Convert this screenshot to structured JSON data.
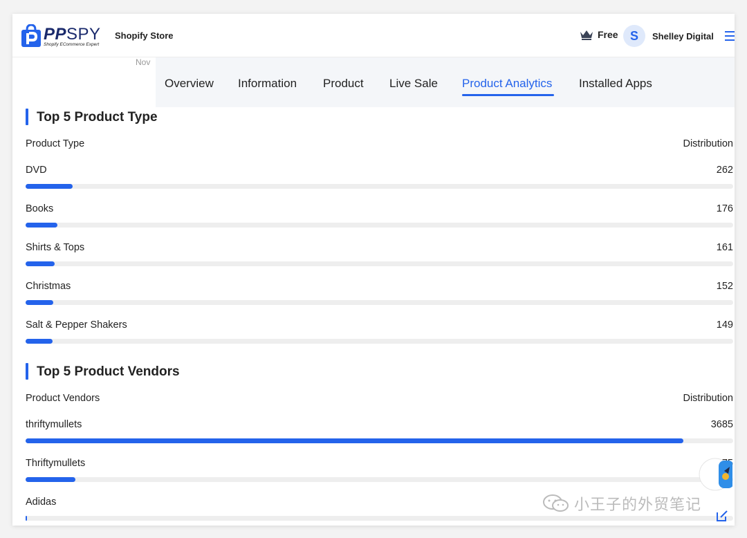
{
  "header": {
    "logo_text_pp": "PP",
    "logo_text_spy": "SPY",
    "logo_tagline": "Shopify ECommerce Expert",
    "store_label": "Shopify Store",
    "plan_icon": "crown-icon",
    "plan_label": "Free",
    "avatar_initial": "S",
    "user_name": "Shelley Digital",
    "menu_icon": "hamburger-menu-icon"
  },
  "nov_label": "Nov",
  "tabs": [
    {
      "label": "Overview",
      "active": false
    },
    {
      "label": "Information",
      "active": false
    },
    {
      "label": "Product",
      "active": false
    },
    {
      "label": "Live Sale",
      "active": false
    },
    {
      "label": "Product Analytics",
      "active": true
    },
    {
      "label": "Installed Apps",
      "active": false
    }
  ],
  "product_types": {
    "title": "Top 5 Product Type",
    "col_left": "Product Type",
    "col_right": "Distribution",
    "rows": [
      {
        "label": "DVD",
        "value": "262",
        "fraction": 0.066
      },
      {
        "label": "Books",
        "value": "176",
        "fraction": 0.045
      },
      {
        "label": "Shirts & Tops",
        "value": "161",
        "fraction": 0.041
      },
      {
        "label": "Christmas",
        "value": "152",
        "fraction": 0.039
      },
      {
        "label": "Salt & Pepper Shakers",
        "value": "149",
        "fraction": 0.038
      }
    ]
  },
  "product_vendors": {
    "title": "Top 5 Product Vendors",
    "col_left": "Product Vendors",
    "col_right": "Distribution",
    "rows": [
      {
        "label": "thriftymullets",
        "value": "3685",
        "fraction": 0.93
      },
      {
        "label": "Thriftymullets",
        "value": "275",
        "fraction": 0.07
      },
      {
        "label": "Adidas",
        "value": "",
        "fraction": 0.002
      }
    ]
  },
  "watermark_text": "小王子的外贸笔记",
  "colors": {
    "accent": "#2463eb",
    "track": "#eeeeee"
  }
}
